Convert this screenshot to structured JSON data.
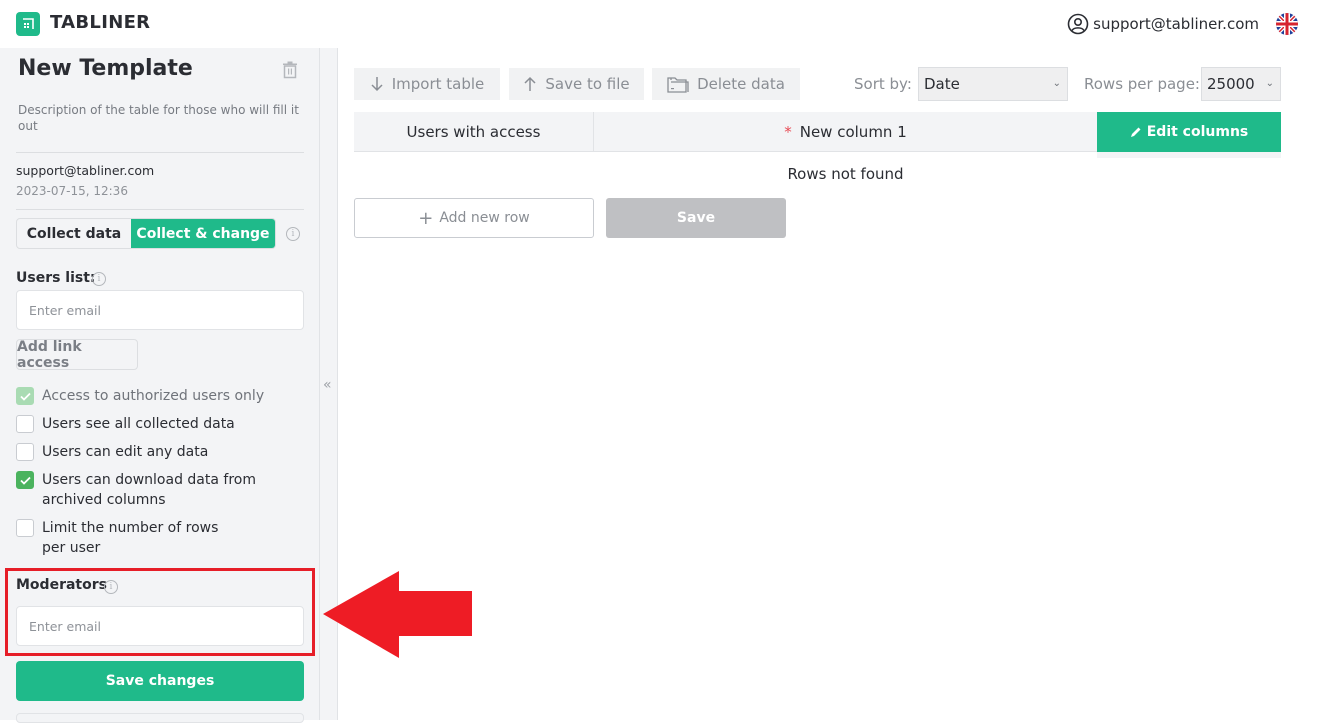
{
  "header": {
    "brand": "TABLINER",
    "user_email": "support@tabliner.com",
    "language_icon": "uk-flag-icon"
  },
  "sidebar": {
    "template_title": "New Template",
    "description": "Description of the table for those who will fill it out",
    "owner_email": "support@tabliner.com",
    "created_at": "2023-07-15, 12:36",
    "mode_options": [
      "Collect data",
      "Collect & change"
    ],
    "mode_selected": "Collect & change",
    "users_list_label": "Users list:",
    "users_email_placeholder": "Enter email",
    "add_link_access_label": "Add link access",
    "checkboxes": [
      {
        "label": "Access to authorized users only",
        "checked": true,
        "disabled": true
      },
      {
        "label": "Users see all collected data",
        "checked": false,
        "disabled": false
      },
      {
        "label": "Users can edit any data",
        "checked": false,
        "disabled": false
      },
      {
        "label": "Users can download data from archived columns",
        "checked": true,
        "disabled": false
      },
      {
        "label": "Limit the number of rows per user",
        "checked": false,
        "disabled": false
      }
    ],
    "moderators_label": "Moderators",
    "moderators_email_placeholder": "Enter email",
    "save_changes_label": "Save changes"
  },
  "toolbar": {
    "import_label": "Import table",
    "save_to_file_label": "Save to file",
    "delete_label": "Delete data",
    "sort_label": "Sort by:",
    "sort_value": "Date",
    "rows_per_page_label": "Rows per page:",
    "rows_per_page_value": "25000"
  },
  "table": {
    "columns": [
      "Users with access",
      "New column 1"
    ],
    "required_marker": "*",
    "edit_columns_label": "Edit columns",
    "empty_message": "Rows not found",
    "add_row_label": "Add new row",
    "save_label": "Save"
  },
  "annotation": {
    "highlight_color": "#e61e28",
    "target": "Moderators"
  },
  "colors": {
    "accent": "#1fba8a",
    "checkbox_checked": "#4bb35e",
    "annotation_red": "#e61e28"
  }
}
